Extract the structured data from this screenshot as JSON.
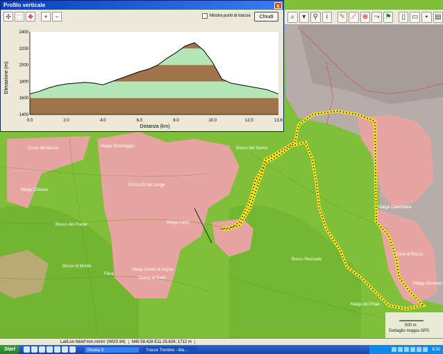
{
  "profile_window": {
    "title": "Profilo verticale",
    "close_glyph": "x",
    "show_points_label": "Mostra punti di traccia",
    "close_button": "Chiudi",
    "tools": [
      "move-cross-icon",
      "zoom-box-icon",
      "pan-icon",
      "zoom-in-icon",
      "zoom-out-icon"
    ],
    "tool_glyphs": [
      "✣",
      "⬚",
      "✥",
      "+",
      "−"
    ]
  },
  "chart_data": {
    "type": "area",
    "xlabel": "Distanza (km)",
    "ylabel": "Elevazione (m)",
    "xlim": [
      0.0,
      13.6
    ],
    "ylim": [
      1400,
      2400
    ],
    "x_ticks": [
      "0.0",
      "2.0",
      "4.0",
      "6.0",
      "8.0",
      "10.0",
      "12.0",
      "13.6"
    ],
    "y_ticks": [
      "1400",
      "1600",
      "1800",
      "2000",
      "2200",
      "2400"
    ],
    "bands": [
      {
        "from": 1400,
        "to": 1600,
        "color": "#a0734a"
      },
      {
        "from": 1600,
        "to": 1800,
        "color": "#b4e6b8"
      },
      {
        "from": 1800,
        "to": 2000,
        "color": "#a0734a"
      },
      {
        "from": 2000,
        "to": 2200,
        "color": "#b4e6b8"
      },
      {
        "from": 2200,
        "to": 2400,
        "color": "#a0734a"
      }
    ],
    "x": [
      0.0,
      0.5,
      1.0,
      1.5,
      2.0,
      2.5,
      3.0,
      3.5,
      4.0,
      4.5,
      5.0,
      5.5,
      6.0,
      6.5,
      7.0,
      7.5,
      8.0,
      8.5,
      9.0,
      9.5,
      10.0,
      10.5,
      11.0,
      11.5,
      12.0,
      12.5,
      13.0,
      13.6
    ],
    "y": [
      1650,
      1680,
      1720,
      1750,
      1770,
      1780,
      1790,
      1780,
      1760,
      1800,
      1840,
      1880,
      1920,
      1950,
      2000,
      2080,
      2150,
      2230,
      2270,
      2180,
      2030,
      1830,
      1780,
      1760,
      1740,
      1720,
      1700,
      1650
    ]
  },
  "toolbar_icons": [
    "binoculars-icon",
    "filter-icon",
    "search-icon",
    "info-icon",
    "pencil-icon",
    "measure-icon",
    "gps-icon",
    "track-icon",
    "waypoint-icon",
    "new-icon",
    "open-icon",
    "save-icon",
    "print-icon"
  ],
  "map": {
    "scale_label": "500 m",
    "credit": "Dettaglio mappa GPS",
    "colors": {
      "forest": "#7fbf3a",
      "meadow": "#e8a4a0",
      "rock": "#b8aca8",
      "track": "#f5e61a"
    },
    "labels": [
      "Malga Stramaggio",
      "Malga Dosso di Sopra",
      "Pozza Di Val Lunge",
      "Bosco del Pradel",
      "Malga Larici",
      "Dosso di Sotto",
      "Bosco Resicada",
      "Cima di Rozza",
      "Malga Colombara",
      "Malga Mondato",
      "Bosco del Sarmo",
      "Fiera",
      "Malga Cimana",
      "Bosco di Monte",
      "Malga dei Pradi",
      "Croce del Bassa"
    ]
  },
  "statusbar": {
    "coords_label": "Lat/Lon hddd°mm.mmm' (WGS 84)",
    "coords_value": "N45 58.428 E11 25.624, 1712 m"
  },
  "taskbar": {
    "start": "Start",
    "tasks": [
      "Picasa 3",
      "Tracce Trentino - Ma..."
    ],
    "clock": "8:30"
  }
}
